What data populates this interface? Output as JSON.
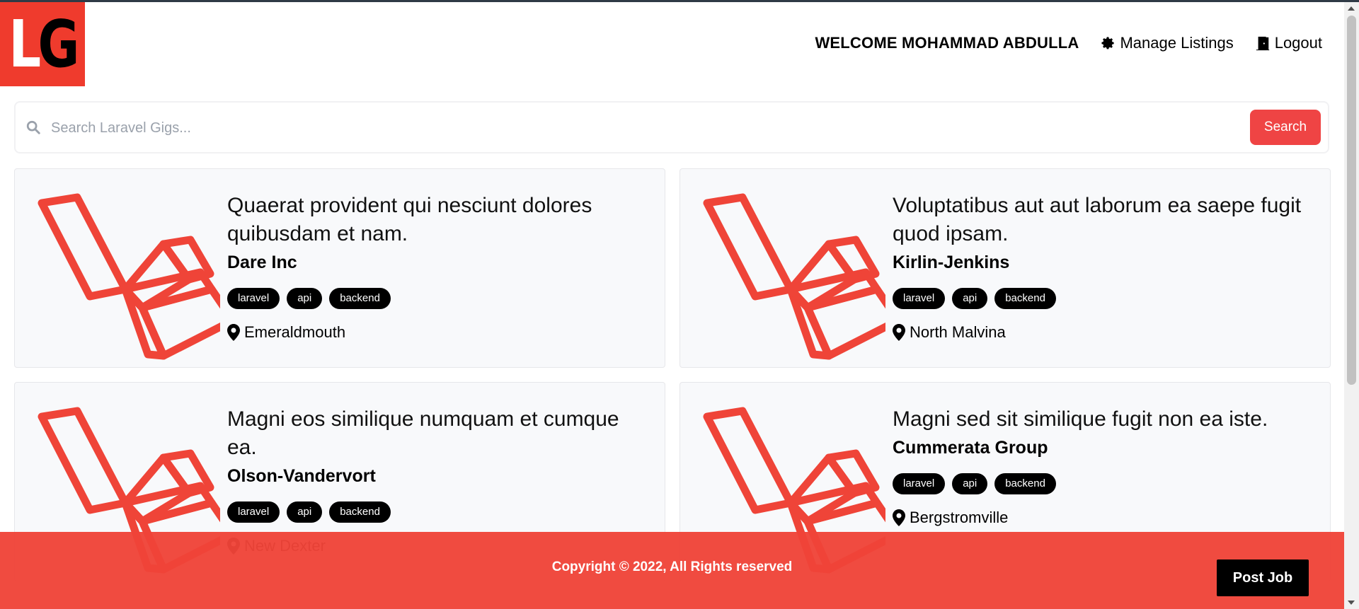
{
  "brand": {
    "logo_text_a": "L",
    "logo_text_b": "G",
    "color": "#ef3b2d"
  },
  "nav": {
    "welcome": "WELCOME MOHAMMAD ABDULLA",
    "manage_listings": "Manage Listings",
    "logout": "Logout",
    "manage_icon": "gear-icon",
    "logout_icon": "door-icon"
  },
  "search": {
    "placeholder": "Search Laravel Gigs...",
    "button_label": "Search",
    "icon": "search-icon"
  },
  "listings": [
    {
      "title": "Quaerat provident qui nesciunt dolores quibusdam et nam.",
      "company": "Dare Inc",
      "tags": [
        "laravel",
        "api",
        "backend"
      ],
      "location": "Emeraldmouth"
    },
    {
      "title": "Voluptatibus aut aut laborum ea saepe fugit quod ipsam.",
      "company": "Kirlin-Jenkins",
      "tags": [
        "laravel",
        "api",
        "backend"
      ],
      "location": "North Malvina"
    },
    {
      "title": "Magni eos similique numquam et cumque ea.",
      "company": "Olson-Vandervort",
      "tags": [
        "laravel",
        "api",
        "backend"
      ],
      "location": "New Dexter"
    },
    {
      "title": "Magni sed sit similique fugit non ea iste.",
      "company": "Cummerata Group",
      "tags": [
        "laravel",
        "api",
        "backend"
      ],
      "location": "Bergstromville"
    }
  ],
  "footer": {
    "copyright": "Copyright © 2022, All Rights reserved",
    "post_job": "Post Job",
    "color": "#ef4438"
  },
  "colors": {
    "accent": "#ef4444",
    "tag_bg": "#000000",
    "card_bg": "#f8f9fb"
  }
}
